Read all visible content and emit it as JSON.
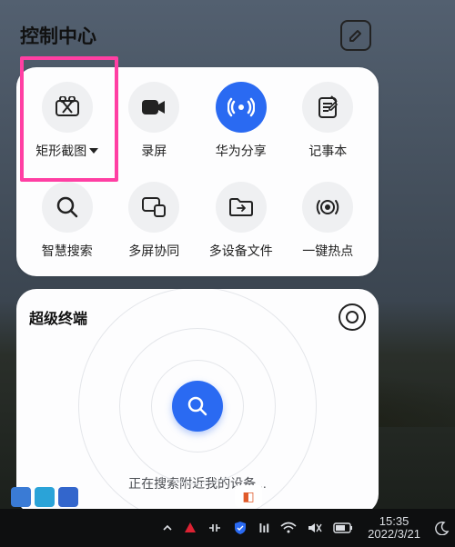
{
  "panel": {
    "title": "控制中心",
    "tiles": [
      {
        "id": "screenshot",
        "label": "矩形截图",
        "hasDropdown": true,
        "blue": false
      },
      {
        "id": "screenrec",
        "label": "录屏",
        "hasDropdown": false,
        "blue": false
      },
      {
        "id": "huaweishare",
        "label": "华为分享",
        "hasDropdown": false,
        "blue": true
      },
      {
        "id": "notepad",
        "label": "记事本",
        "hasDropdown": false,
        "blue": false
      },
      {
        "id": "smartsearch",
        "label": "智慧搜索",
        "hasDropdown": false,
        "blue": false
      },
      {
        "id": "multiscreen",
        "label": "多屏协同",
        "hasDropdown": false,
        "blue": false
      },
      {
        "id": "multidevfiles",
        "label": "多设备文件",
        "hasDropdown": false,
        "blue": false
      },
      {
        "id": "hotspot",
        "label": "一键热点",
        "hasDropdown": false,
        "blue": false
      }
    ]
  },
  "terminal": {
    "title": "超级终端",
    "message": "正在搜索附近我的设备..."
  },
  "taskbar": {
    "time": "15:35",
    "date": "2022/3/21"
  }
}
